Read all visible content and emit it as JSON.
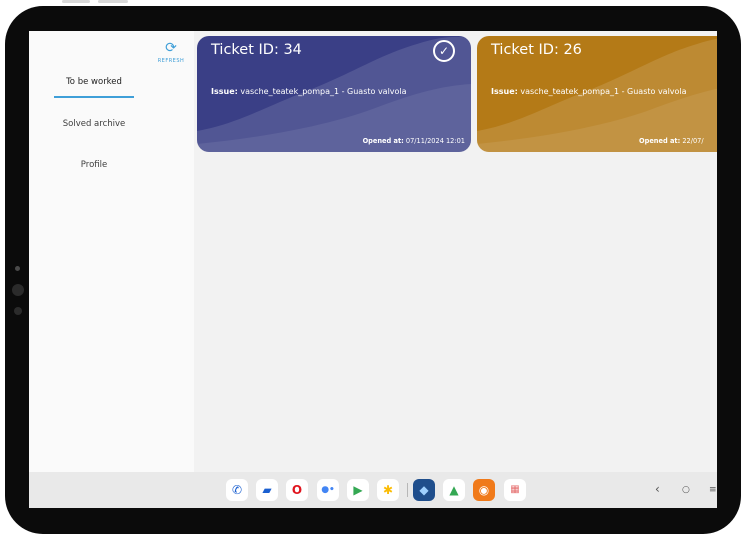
{
  "sidebar": {
    "refresh_label": "REFRESH",
    "items": [
      {
        "label": "To be worked"
      },
      {
        "label": "Solved archive"
      },
      {
        "label": "Profile"
      }
    ]
  },
  "tickets": [
    {
      "title": "Ticket ID: 34",
      "issue_label": "Issue:",
      "issue_text": "vasche_teatek_pompa_1 - Guasto valvola",
      "opened_label": "Opened at:",
      "opened_value": "07/11/2024 12:01",
      "color": "#3a3f86",
      "checked": true
    },
    {
      "title": "Ticket ID: 26",
      "issue_label": "Issue:",
      "issue_text": "vasche_teatek_pompa_1 - Guasto valvola",
      "opened_label": "Opened at:",
      "opened_value": "22/07/",
      "color": "#b47a17",
      "checked": false
    }
  ],
  "taskbar": {
    "apps": [
      "phone",
      "messages",
      "opera",
      "assistant",
      "play-store",
      "photos",
      "app-3d",
      "drive",
      "recorder",
      "app-grid"
    ]
  },
  "colors": {
    "accent": "#3f9fd8",
    "card_blue": "#3a3f86",
    "card_orange": "#b47a17"
  }
}
